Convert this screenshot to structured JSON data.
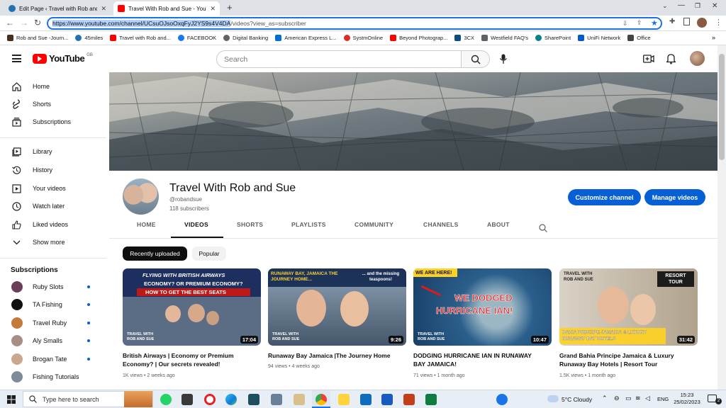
{
  "browser": {
    "tabs": [
      {
        "title": "Edit Page ‹ Travel with Rob and S",
        "active": false
      },
      {
        "title": "Travel With Rob and Sue - YouTu",
        "active": true
      }
    ],
    "url_highlight": "https://www.youtube.com/channel/UCsuOJsoOxqFyJ2YS9s4V4DA",
    "url_rest": "/videos?view_as=subscriber",
    "bookmarks": [
      "Rob and Sue -Journ...",
      "45miles",
      "Travel with Rob and...",
      "FACEBOOK",
      "Digital Banking",
      "American Express L...",
      "SystmOnline",
      "Beyond Photograp...",
      "3CX",
      "Westfield FAQ's",
      "SharePoint",
      "UniFi Network",
      "Office"
    ],
    "more_bookmarks": "»"
  },
  "header": {
    "logo_text": "YouTube",
    "logo_country": "GB",
    "search_placeholder": "Search"
  },
  "sidebar": {
    "main": [
      "Home",
      "Shorts",
      "Subscriptions"
    ],
    "library": [
      "Library",
      "History",
      "Your videos",
      "Watch later",
      "Liked videos",
      "Show more"
    ],
    "subscriptions_heading": "Subscriptions",
    "subscriptions": [
      "Ruby Slots",
      "TA Fishing",
      "Travel Ruby",
      "Aly Smalls",
      "Brogan Tate",
      "Fishing Tutorials"
    ]
  },
  "channel": {
    "name": "Travel With Rob and Sue",
    "handle": "@robandsue",
    "subscribers": "118 subscribers",
    "customize_label": "Customize channel",
    "manage_label": "Manage videos",
    "tabs": [
      "HOME",
      "VIDEOS",
      "SHORTS",
      "PLAYLISTS",
      "COMMUNITY",
      "CHANNELS",
      "ABOUT"
    ],
    "active_tab": "VIDEOS"
  },
  "filters": {
    "recent": "Recently uploaded",
    "popular": "Popular"
  },
  "videos": [
    {
      "title_line1": "British Airways | Economy or Premium",
      "title_line2": "Economy? | Our secrets revealed!",
      "views": "1K views",
      "age": "2 weeks ago",
      "duration": "17:04",
      "thumb_text1": "FLYING WITH BRITISH AIRWAYS",
      "thumb_text2": "ECONOMY? OR PREMIUM ECONOMY?",
      "thumb_text3": "HOW TO GET THE BEST SEATS",
      "thumb_brand": "TRAVEL WITH ROB AND SUE"
    },
    {
      "title_line1": "Runaway Bay Jamaica |The Journey Home",
      "title_line2": "",
      "views": "94 views",
      "age": "4 weeks ago",
      "duration": "9:26",
      "thumb_text1": "RUNAWAY BAY, JAMAICA THE JOURNEY HOME...",
      "thumb_text2": "... and the missing teaspoons!",
      "thumb_brand": "TRAVEL WITH ROB AND SUE"
    },
    {
      "title_line1": "DODGING HURRICANE IAN IN RUNAWAY",
      "title_line2": "BAY JAMAICA!",
      "views": "71 views",
      "age": "1 month ago",
      "duration": "10:47",
      "thumb_text1": "WE ARE HERE!",
      "thumb_text2": "WE DODGED",
      "thumb_text3": "HURRICANE IAN!",
      "thumb_brand": "TRAVEL WITH ROB AND SUE"
    },
    {
      "title_line1": "Grand Bahia Principe Jamaica & Luxury",
      "title_line2": "Runaway Bay Hotels | Resort Tour",
      "views": "1.5K views",
      "age": "1 month ago",
      "duration": "31:42",
      "thumb_text1": "TRAVEL WITH ROB AND SUE",
      "thumb_text2": "RESORT TOUR",
      "thumb_text3": "BAHIA PRINCIPE JAMAICA & LUXURY RUNAWAY BAY HOTELS"
    }
  ],
  "taskbar": {
    "search_placeholder": "Type here to search",
    "weather": "5°C  Cloudy",
    "lang": "ENG",
    "time": "15:23",
    "date": "25/02/2023",
    "notification_count": "2"
  }
}
